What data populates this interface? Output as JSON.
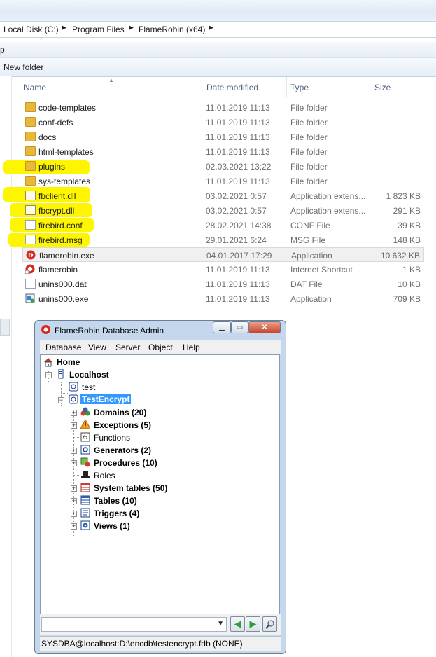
{
  "address": {
    "crumbs": [
      "Local Disk (C:)",
      "Program Files",
      "FlameRobin (x64)"
    ],
    "sep": "▶"
  },
  "menu": {
    "partial": "p"
  },
  "toolbar": {
    "new_folder": "New folder"
  },
  "columns": {
    "name": "Name",
    "date": "Date modified",
    "type": "Type",
    "size": "Size"
  },
  "files": [
    {
      "name": "code-templates",
      "date": "11.01.2019 11:13",
      "type": "File folder",
      "size": "",
      "icon": "folder-icon"
    },
    {
      "name": "conf-defs",
      "date": "11.01.2019 11:13",
      "type": "File folder",
      "size": "",
      "icon": "folder-icon"
    },
    {
      "name": "docs",
      "date": "11.01.2019 11:13",
      "type": "File folder",
      "size": "",
      "icon": "folder-icon"
    },
    {
      "name": "html-templates",
      "date": "11.01.2019 11:13",
      "type": "File folder",
      "size": "",
      "icon": "folder-icon"
    },
    {
      "name": "plugins",
      "date": "02.03.2021 13:22",
      "type": "File folder",
      "size": "",
      "icon": "folder-icon"
    },
    {
      "name": "sys-templates",
      "date": "11.01.2019 11:13",
      "type": "File folder",
      "size": "",
      "icon": "folder-icon"
    },
    {
      "name": "fbclient.dll",
      "date": "03.02.2021 0:57",
      "type": "Application extens...",
      "size": "1 823 KB",
      "icon": "dll-icon"
    },
    {
      "name": "fbcrypt.dll",
      "date": "03.02.2021 0:57",
      "type": "Application extens...",
      "size": "291 KB",
      "icon": "dll-icon"
    },
    {
      "name": "firebird.conf",
      "date": "28.02.2021 14:38",
      "type": "CONF File",
      "size": "39 KB",
      "icon": "file-icon"
    },
    {
      "name": "firebird.msg",
      "date": "29.01.2021 6:24",
      "type": "MSG File",
      "size": "148 KB",
      "icon": "file-icon"
    },
    {
      "name": "flamerobin.exe",
      "date": "04.01.2017 17:29",
      "type": "Application",
      "size": "10 632 KB",
      "icon": "flamerobin-icon"
    },
    {
      "name": "flamerobin",
      "date": "11.01.2019 11:13",
      "type": "Internet Shortcut",
      "size": "1 KB",
      "icon": "shortcut-icon"
    },
    {
      "name": "unins000.dat",
      "date": "11.01.2019 11:13",
      "type": "DAT File",
      "size": "10 KB",
      "icon": "file-icon"
    },
    {
      "name": "unins000.exe",
      "date": "11.01.2019 11:13",
      "type": "Application",
      "size": "709 KB",
      "icon": "installer-icon"
    }
  ],
  "highlight_color": "#fdf600",
  "flamerobin": {
    "title": "FlameRobin Database Admin",
    "menu": [
      "Database",
      "View",
      "Server",
      "Object",
      "Help"
    ],
    "tree": {
      "home": "Home",
      "server": "Localhost",
      "db1": "test",
      "db2": "TestEncrypt",
      "items": [
        {
          "label": "Domains (20)",
          "bold": true,
          "expand": true,
          "icon": "domains-icon"
        },
        {
          "label": "Exceptions (5)",
          "bold": true,
          "expand": true,
          "icon": "exceptions-icon"
        },
        {
          "label": "Functions",
          "bold": false,
          "expand": false,
          "icon": "functions-icon"
        },
        {
          "label": "Generators (2)",
          "bold": true,
          "expand": true,
          "icon": "generators-icon"
        },
        {
          "label": "Procedures (10)",
          "bold": true,
          "expand": true,
          "icon": "procedures-icon"
        },
        {
          "label": "Roles",
          "bold": false,
          "expand": false,
          "icon": "roles-icon"
        },
        {
          "label": "System tables (50)",
          "bold": true,
          "expand": true,
          "icon": "system-tables-icon"
        },
        {
          "label": "Tables (10)",
          "bold": true,
          "expand": true,
          "icon": "tables-icon"
        },
        {
          "label": "Triggers (4)",
          "bold": true,
          "expand": true,
          "icon": "triggers-icon"
        },
        {
          "label": "Views (1)",
          "bold": true,
          "expand": true,
          "icon": "views-icon"
        }
      ]
    },
    "status": "SYSDBA@localhost:D:\\encdb\\testencrypt.fdb (NONE)",
    "selected_color": "#3399ff"
  }
}
